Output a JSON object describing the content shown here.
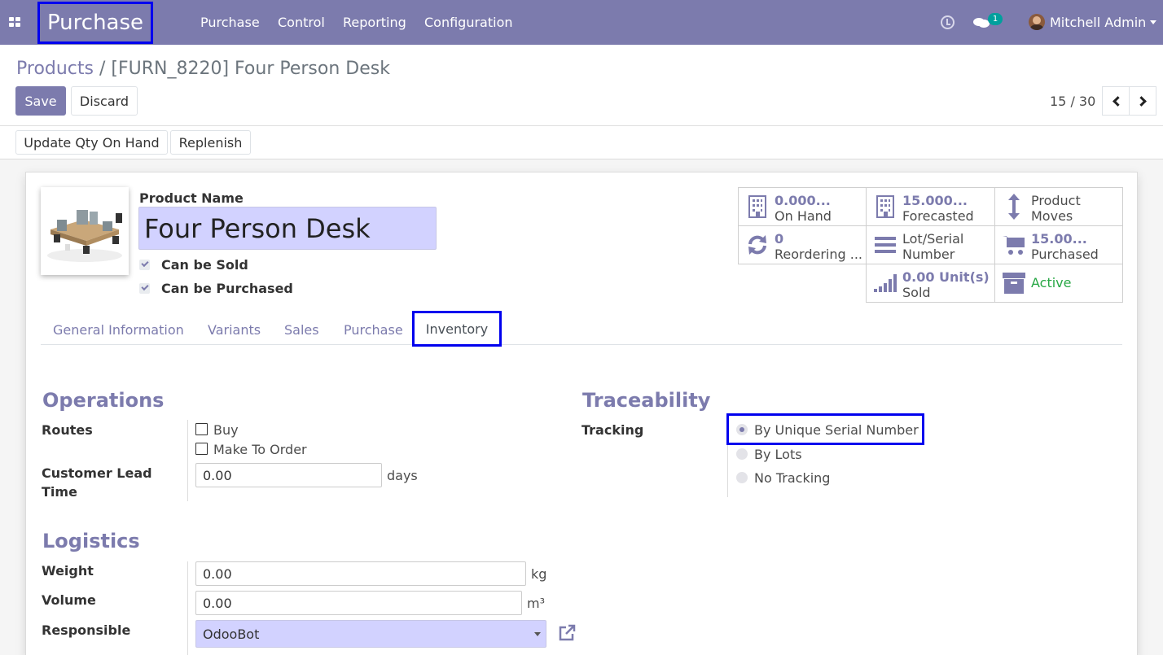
{
  "navbar": {
    "brand": "Purchase",
    "menu": [
      "Purchase",
      "Control",
      "Reporting",
      "Configuration"
    ],
    "chat_badge": "1",
    "user": "Mitchell Admin"
  },
  "breadcrumb": {
    "parent": "Products",
    "separator": " / ",
    "current": "[FURN_8220] Four Person Desk"
  },
  "toolbar": {
    "save": "Save",
    "discard": "Discard"
  },
  "pager": {
    "value": "15 / 30"
  },
  "statusbar": {
    "update_qty": "Update Qty On Hand",
    "replenish": "Replenish"
  },
  "product": {
    "name_label": "Product Name",
    "name": "Four Person Desk",
    "can_be_sold": "Can be Sold",
    "can_be_purchased": "Can be Purchased"
  },
  "smart_buttons": {
    "on_hand": {
      "value": "0.000...",
      "label": "On Hand"
    },
    "forecasted": {
      "value": "15.000...",
      "label": "Forecasted"
    },
    "product_moves": {
      "line1": "Product",
      "line2": "Moves"
    },
    "reordering": {
      "value": "0",
      "label": "Reordering ..."
    },
    "lot_serial": {
      "line1": "Lot/Serial",
      "line2": "Number"
    },
    "purchased": {
      "value": "15.00...",
      "label": "Purchased"
    },
    "sold": {
      "value": "0.00 Unit(s)",
      "label": "Sold"
    },
    "active": {
      "label": "Active"
    }
  },
  "tabs": [
    "General Information",
    "Variants",
    "Sales",
    "Purchase",
    "Inventory"
  ],
  "operations": {
    "title": "Operations",
    "routes_label": "Routes",
    "route_buy": "Buy",
    "route_mto": "Make To Order",
    "lead_time_label_1": "Customer Lead",
    "lead_time_label_2": "Time",
    "lead_time_value": "0.00",
    "lead_time_unit": "days"
  },
  "traceability": {
    "title": "Traceability",
    "tracking_label": "Tracking",
    "options": [
      "By Unique Serial Number",
      "By Lots",
      "No Tracking"
    ],
    "selected": "By Unique Serial Number"
  },
  "logistics": {
    "title": "Logistics",
    "weight_label": "Weight",
    "weight_value": "0.00",
    "weight_unit": "kg",
    "volume_label": "Volume",
    "volume_value": "0.00",
    "volume_unit": "m³",
    "responsible_label": "Responsible",
    "responsible_value": "OdooBot"
  },
  "colors": {
    "brand": "#7c7bad",
    "highlight": "#0000ee",
    "active_green": "#28a745",
    "required_field": "#d2d2ff"
  }
}
